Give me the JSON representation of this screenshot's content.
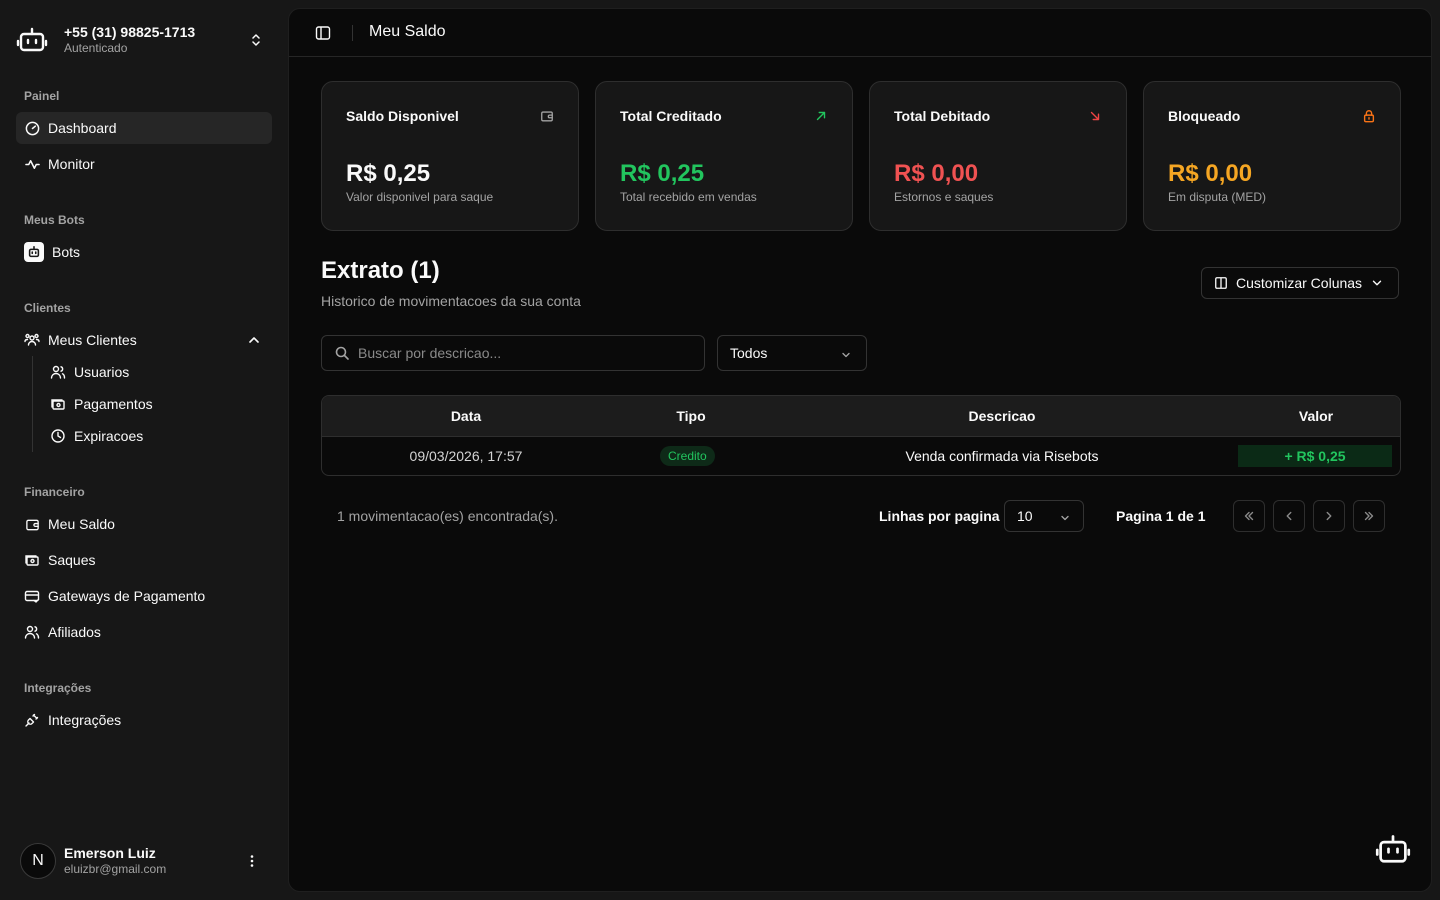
{
  "account": {
    "phone": "+55 (31) 98825-1713",
    "status": "Autenticado"
  },
  "sidebar": {
    "groups": [
      {
        "label": "Painel"
      },
      {
        "label": "Meus Bots"
      },
      {
        "label": "Clientes"
      },
      {
        "label": "Financeiro"
      },
      {
        "label": "Integrações"
      }
    ],
    "items": {
      "dashboard": "Dashboard",
      "monitor": "Monitor",
      "bots": "Bots",
      "clientes": "Meus Clientes",
      "usuarios": "Usuarios",
      "pagamentos": "Pagamentos",
      "expiracoes": "Expiracoes",
      "saldo": "Meu Saldo",
      "saques": "Saques",
      "gateways": "Gateways de Pagamento",
      "afiliados": "Afiliados",
      "integracoes": "Integrações"
    }
  },
  "user": {
    "initial": "N",
    "name": "Emerson Luiz",
    "email": "eluizbr@gmail.com"
  },
  "header": {
    "title": "Meu Saldo"
  },
  "cards": [
    {
      "title": "Saldo Disponivel",
      "value": "R$ 0,25",
      "subtitle": "Valor disponivel para saque",
      "color": "#fafafa"
    },
    {
      "title": "Total Creditado",
      "value": "R$ 0,25",
      "subtitle": "Total recebido em vendas",
      "color": "#22c55e"
    },
    {
      "title": "Total Debitado",
      "value": "R$ 0,00",
      "subtitle": "Estornos e saques",
      "color": "#f05252"
    },
    {
      "title": "Bloqueado",
      "value": "R$ 0,00",
      "subtitle": "Em disputa (MED)",
      "color": "#f5a623"
    }
  ],
  "extrato": {
    "title": "Extrato (1)",
    "subtitle": "Historico de movimentacoes da sua conta",
    "customize_label": "Customizar Colunas",
    "search_placeholder": "Buscar por descricao...",
    "filter_value": "Todos"
  },
  "table": {
    "columns": [
      "Data",
      "Tipo",
      "Descricao",
      "Valor"
    ],
    "rows": [
      {
        "data": "09/03/2026, 17:57",
        "tipo": "Credito",
        "descricao": "Venda confirmada via Risebots",
        "valor": "+ R$ 0,25"
      }
    ]
  },
  "pagination": {
    "count_text": "1 movimentacao(es) encontrada(s).",
    "rows_label": "Linhas por pagina",
    "rows_value": "10",
    "page_text": "Pagina 1 de 1"
  }
}
